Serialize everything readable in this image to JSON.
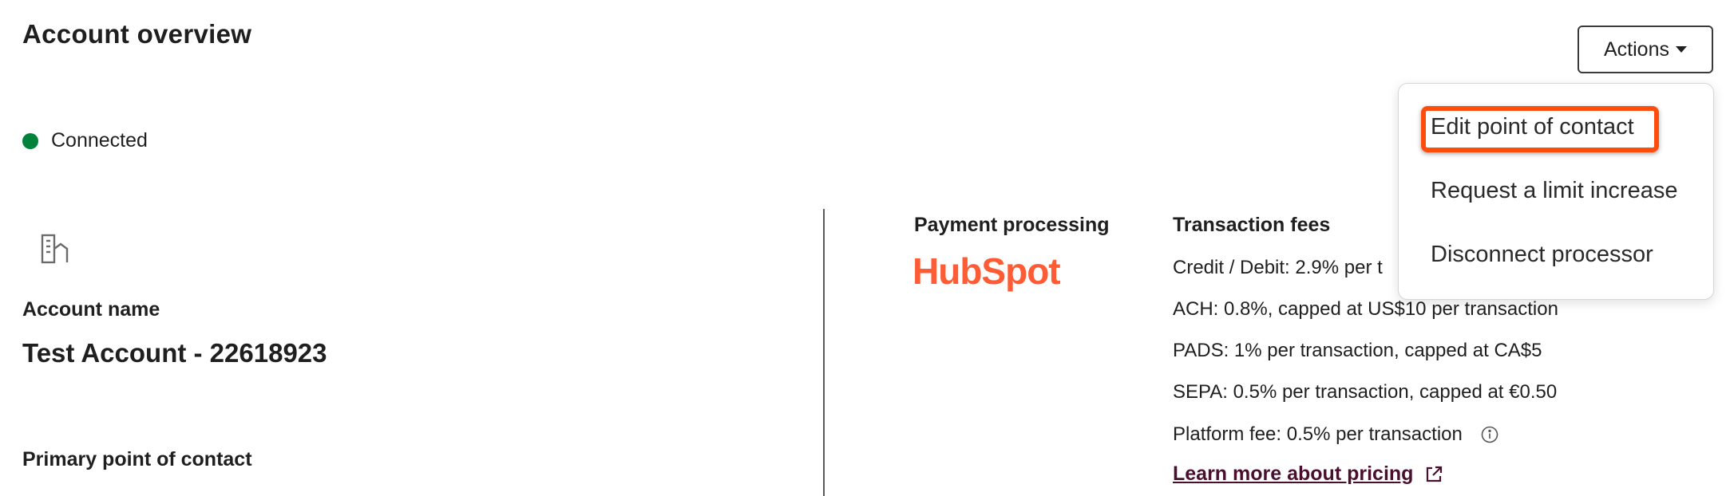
{
  "page": {
    "title": "Account overview"
  },
  "status": {
    "label": "Connected",
    "color": "#00823a"
  },
  "account": {
    "icon": "building-icon",
    "name_label": "Account name",
    "name": "Test Account - 22618923",
    "primary_contact_label": "Primary point of contact"
  },
  "payment_processing": {
    "label": "Payment processing",
    "logo_text": "HubSpot",
    "logo_color": "#ff5c35"
  },
  "transaction_fees": {
    "label": "Transaction fees",
    "items": [
      "Credit / Debit: 2.9% per t",
      "ACH: 0.8%, capped at US$10 per transaction",
      "PADS: 1% per transaction, capped at CA$5",
      "SEPA: 0.5% per transaction, capped at €0.50",
      "Platform fee: 0.5% per transaction"
    ],
    "info_icon": "info-icon",
    "pricing_link": "Learn more about pricing",
    "pricing_link_icon": "external-link-icon"
  },
  "actions": {
    "button_label": "Actions",
    "menu": [
      "Edit point of contact",
      "Request a limit increase",
      "Disconnect processor"
    ],
    "highlight_color": "#ff4d0d"
  }
}
